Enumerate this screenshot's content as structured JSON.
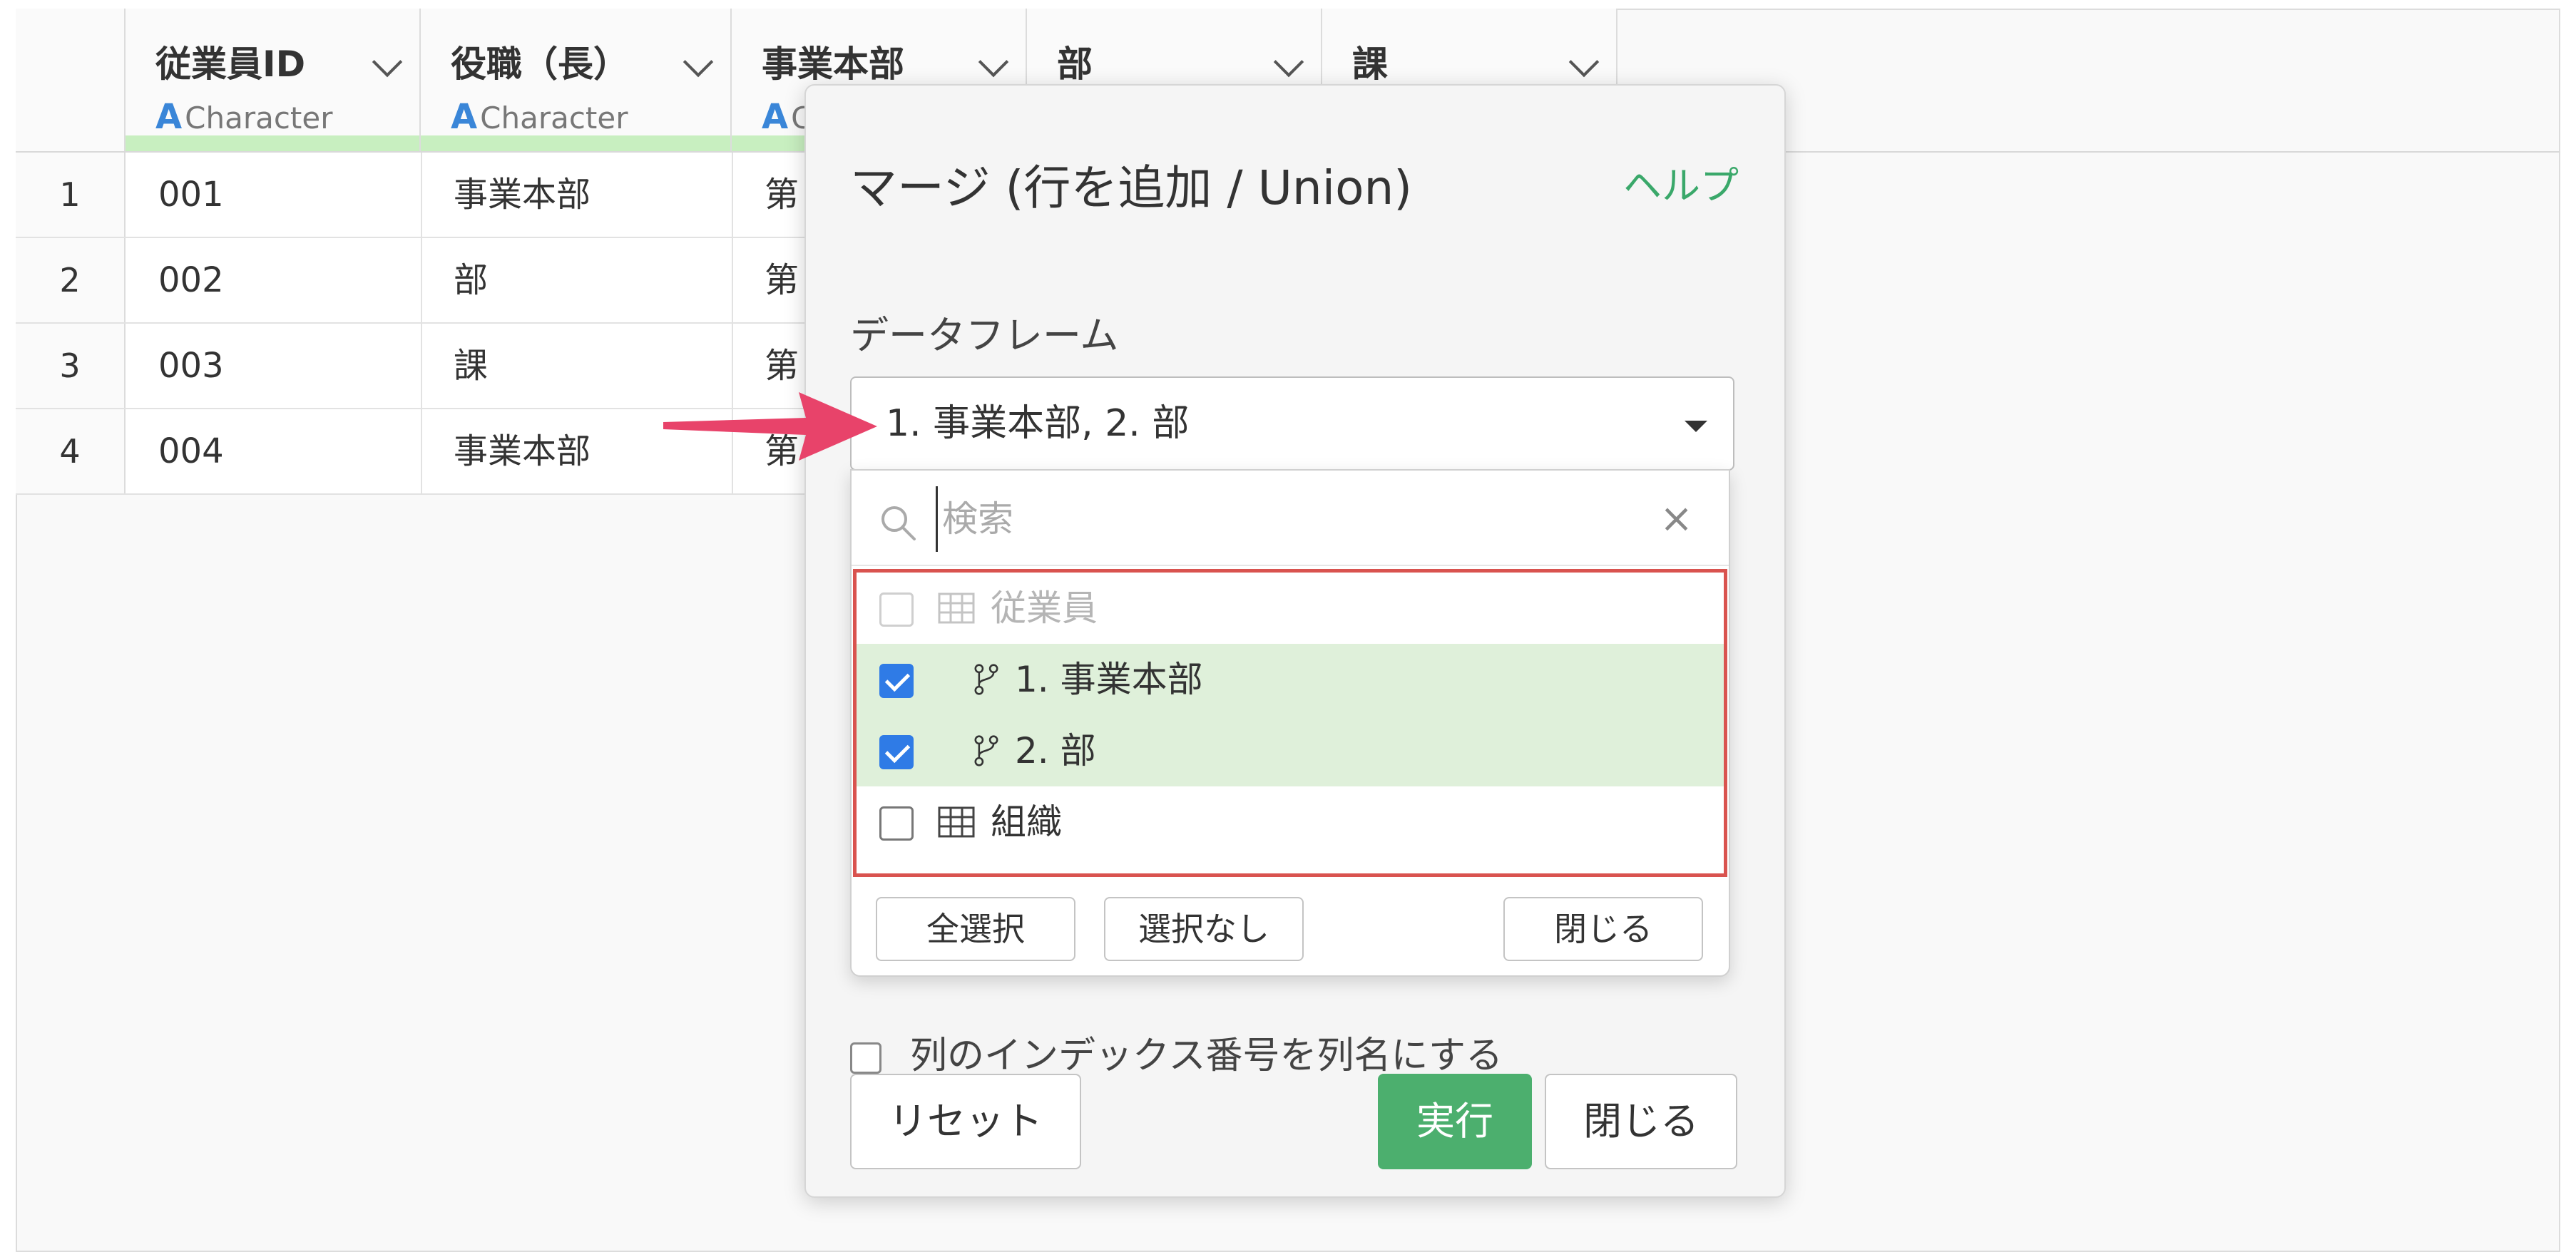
{
  "table": {
    "columns": [
      {
        "name": "従業員ID",
        "type": "Character"
      },
      {
        "name": "役職（長）",
        "type": "Character"
      },
      {
        "name": "事業本部",
        "type": "Character"
      },
      {
        "name": "部",
        "type": ""
      },
      {
        "name": "課",
        "type": ""
      }
    ],
    "type_icon": "A",
    "rows": [
      {
        "num": "1",
        "id": "001",
        "role": "事業本部",
        "div": "第"
      },
      {
        "num": "2",
        "id": "002",
        "role": "部",
        "div": "第"
      },
      {
        "num": "3",
        "id": "003",
        "role": "課",
        "div": "第"
      },
      {
        "num": "4",
        "id": "004",
        "role": "事業本部",
        "div": "第"
      }
    ]
  },
  "modal": {
    "title": "マージ (行を追加 / Union)",
    "help": "ヘルプ",
    "dataframe_label": "データフレーム",
    "dataframe_value": "1. 事業本部, 2. 部",
    "hidden_checkbox_label": "列のインデックス番号を列名にする",
    "reset_label": "リセット",
    "run_label": "実行",
    "close_label": "閉じる"
  },
  "dropdown": {
    "search_placeholder": "検索",
    "search_value": "",
    "clear_glyph": "×",
    "options": [
      {
        "label": "従業員",
        "icon": "table-icon",
        "checked": false,
        "disabled": true
      },
      {
        "label": "1. 事業本部",
        "icon": "branch-icon",
        "checked": true,
        "disabled": false
      },
      {
        "label": "2. 部",
        "icon": "branch-icon",
        "checked": true,
        "disabled": false
      },
      {
        "label": "組織",
        "icon": "table-icon",
        "checked": false,
        "disabled": false
      }
    ],
    "select_all_label": "全選択",
    "select_none_label": "選択なし",
    "close_label": "閉じる"
  },
  "colors": {
    "accent_green": "#4caf6e",
    "help_green": "#3aa86a",
    "checkbox_blue": "#2f7be6",
    "selected_row": "#dff0da",
    "highlight_border": "#d9534f",
    "arrow": "#e8436a"
  }
}
